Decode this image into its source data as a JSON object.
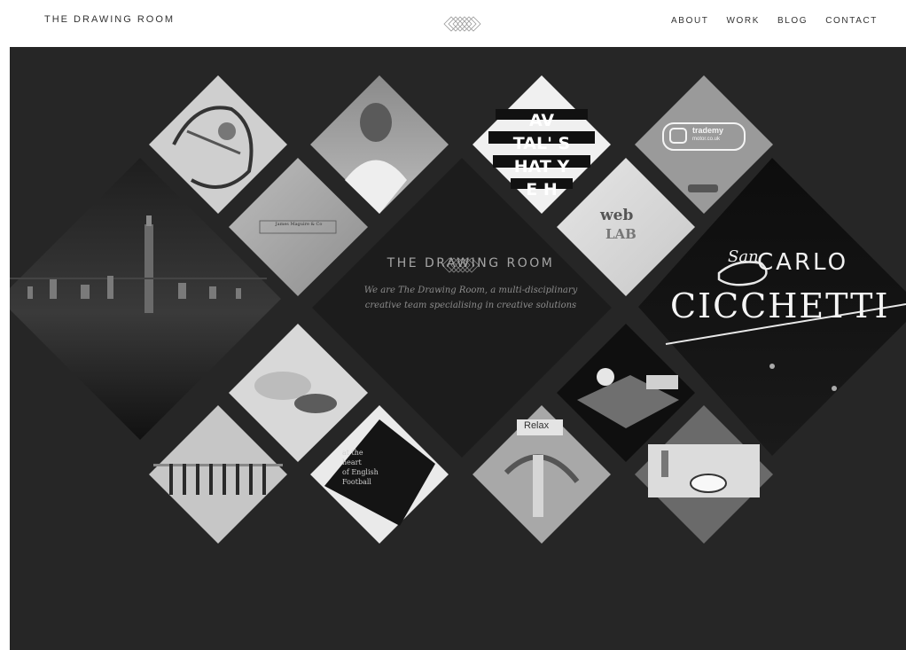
{
  "header": {
    "logo_text": "THE DRAWING ROOM",
    "emblem_icon": "diamond-lattice-icon"
  },
  "nav": {
    "items": [
      {
        "label": "ABOUT"
      },
      {
        "label": "WORK"
      },
      {
        "label": "BLOG"
      },
      {
        "label": "CONTACT"
      }
    ]
  },
  "center": {
    "title": "THE DRAWING ROOM",
    "tagline_line1": "We are The Drawing Room, a multi-disciplinary",
    "tagline_line2": "creative team specialising in creative solutions"
  },
  "tiles": {
    "james_maguire": "James Maguire & Co",
    "trademy_brand": "trademy",
    "trademy_sub": "motor.co.uk",
    "weblab_1": "web",
    "weblab_2": "LAB",
    "poster_text": "AV\nTAL' S\nHAT Y\nE H",
    "carlo_1": "San",
    "carlo_2": "CARLO",
    "carlo_3": "CICCHETTI",
    "relax": "Relax",
    "football_text": "at the\nheart\nof English\nFootball"
  },
  "colors": {
    "page_bg": "#262626",
    "header_bg": "#ffffff",
    "text_dark": "#333333",
    "center_text": "#a5a5a5"
  }
}
